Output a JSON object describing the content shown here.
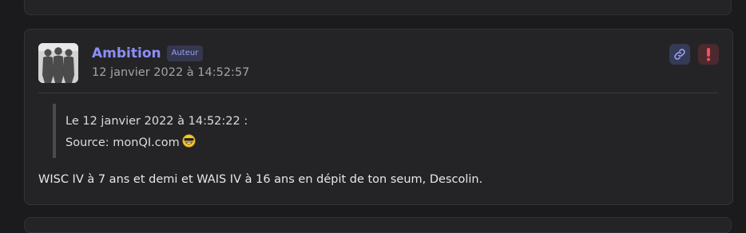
{
  "post": {
    "author": "Ambition",
    "badge": "Auteur",
    "date": "12 janvier 2022 à 14:52:57",
    "quote": {
      "header": "Le 12 janvier 2022 à 14:52:22 :",
      "source_label": "Source: ",
      "source_text": "monQI.com",
      "emoji": "grinning-sunglasses-emoji"
    },
    "body": "WISC IV à 7 ans et demi et WAIS IV à 16 ans en dépit de ton seum, Descolin."
  },
  "icons": {
    "link": "link-icon",
    "report": "exclamation-icon"
  },
  "colors": {
    "background": "#1b1b1d",
    "card": "#242427",
    "author": "#8b8ff5",
    "badge_bg": "#34374e",
    "link_btn_bg": "#353a55",
    "report_btn_bg": "#4a2a2f",
    "report_icon": "#ff4d57"
  }
}
